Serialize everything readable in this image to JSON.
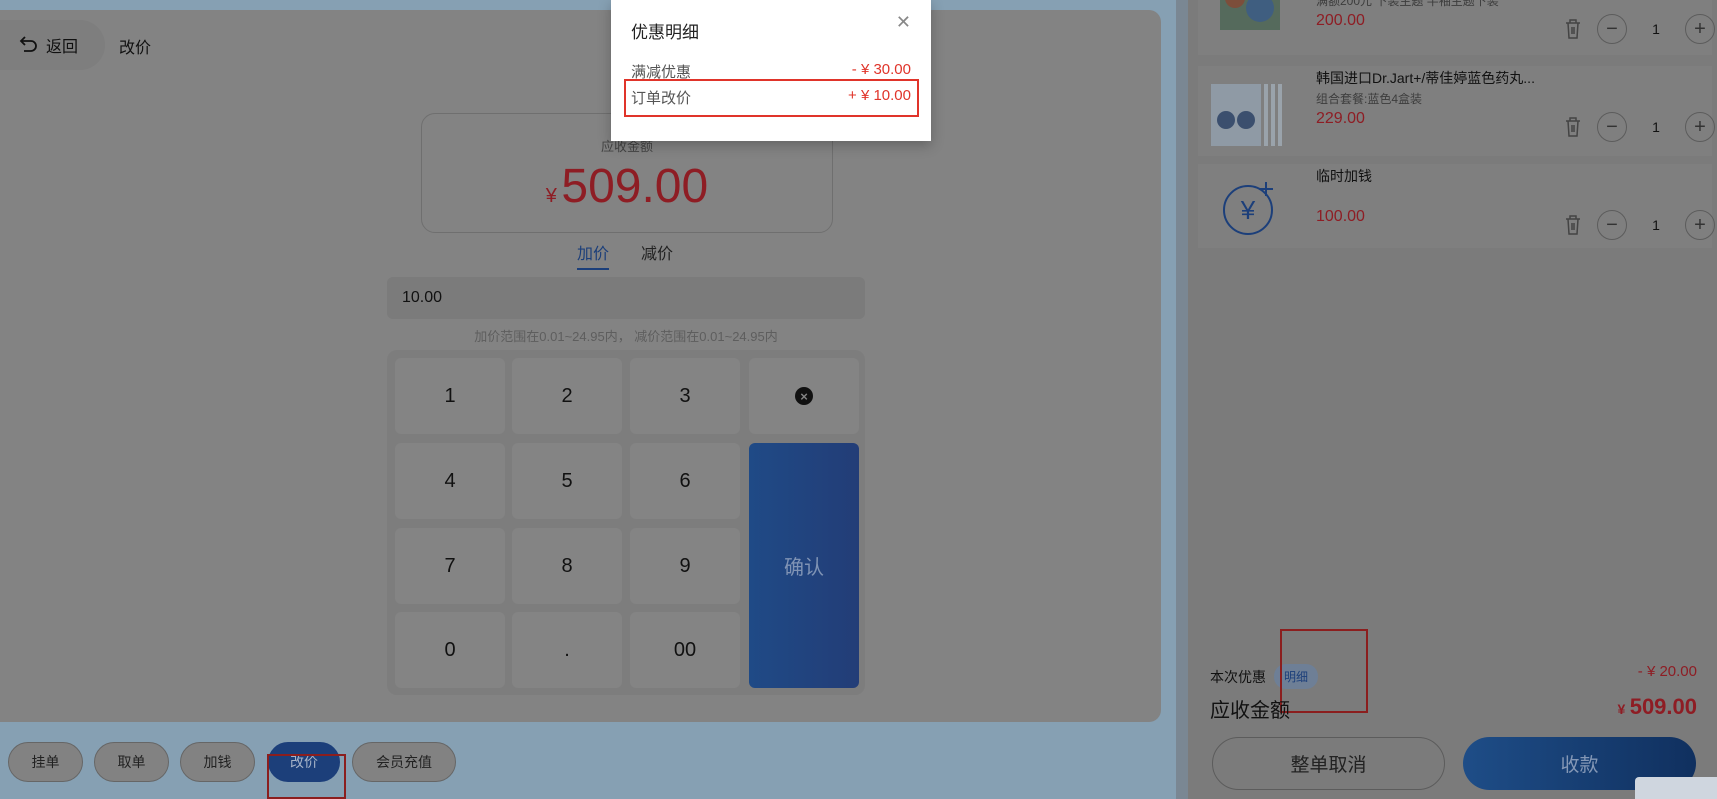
{
  "left": {
    "back_label": "返回",
    "page_title": "改价",
    "amount_label": "应收金额",
    "amount_currency": "¥",
    "amount_value": "509.00",
    "tabs": [
      "加价",
      "减价"
    ],
    "input_value": "10.00",
    "hint": "加价范围在0.01~24.95内， 减价范围在0.01~24.95内",
    "keypad": {
      "keys": [
        "1",
        "2",
        "3",
        "4",
        "5",
        "6",
        "7",
        "8",
        "9",
        "0",
        ".",
        "00"
      ],
      "delete_icon": "clear-icon",
      "confirm": "确认"
    },
    "bottom_actions": [
      "挂单",
      "取单",
      "加钱",
      "改价",
      "会员充值"
    ],
    "active_action": "改价"
  },
  "cart": {
    "items": [
      {
        "title": "",
        "subtitle": "满额200元 下装主题 半袖主题下装",
        "price": "200.00",
        "qty": "1",
        "thumb": "product-art-thumb"
      },
      {
        "title": "韩国进口Dr.Jart+/蒂佳婷蓝色药丸...",
        "subtitle": "组合套餐:蓝色4盒装",
        "price": "229.00",
        "qty": "1",
        "thumb": "product-box-thumb"
      },
      {
        "title": "临时加钱",
        "subtitle": "",
        "price": "100.00",
        "qty": "1",
        "thumb": "yen-add-icon"
      }
    ],
    "discount_label": "本次优惠",
    "detail_badge": "明细",
    "discount_value": "- ¥ 20.00",
    "receivable_label": "应收金额",
    "receivable_currency": "¥",
    "receivable_value": "509.00",
    "cancel_label": "整单取消",
    "pay_label": "收款"
  },
  "modal": {
    "title": "优惠明细",
    "rows": [
      {
        "label": "满减优惠",
        "value": "- ¥ 30.00"
      },
      {
        "label": "订单改价",
        "value": "+ ¥ 10.00"
      }
    ]
  },
  "colors": {
    "accent": "#1c3f7a",
    "price_red": "#8e1d24",
    "highlight_red": "#e0342a",
    "overlay": "#838383"
  }
}
